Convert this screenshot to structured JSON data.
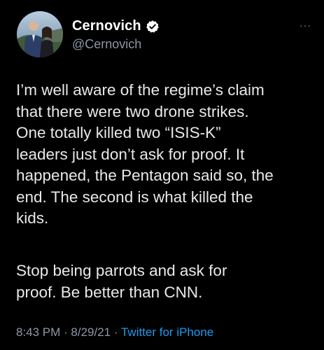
{
  "tweet": {
    "display_name": "Cernovich",
    "handle": "@Cernovich",
    "more_label": "···",
    "paragraphs": [
      "I’m well aware of the regime’s claim\nthat there were two drone strikes.\nOne totally killed two “ISIS-K”\nleaders just don’t ask for proof. It\nhappened, the Pentagon said so, the\nend. The second is what killed the\nkids.",
      "Stop being parrots and ask for\nproof. Be better than CNN."
    ],
    "time": "8:43 PM",
    "date": "8/29/21",
    "separator": " · ",
    "source": "Twitter for iPhone"
  },
  "icons": {
    "verified": "verified-badge-icon",
    "more": "more-dots-icon",
    "avatar": "profile-photo"
  },
  "colors": {
    "background": "#000000",
    "text": "#e7e9ea",
    "secondary": "#8b98a5",
    "link": "#1d9bf0"
  }
}
